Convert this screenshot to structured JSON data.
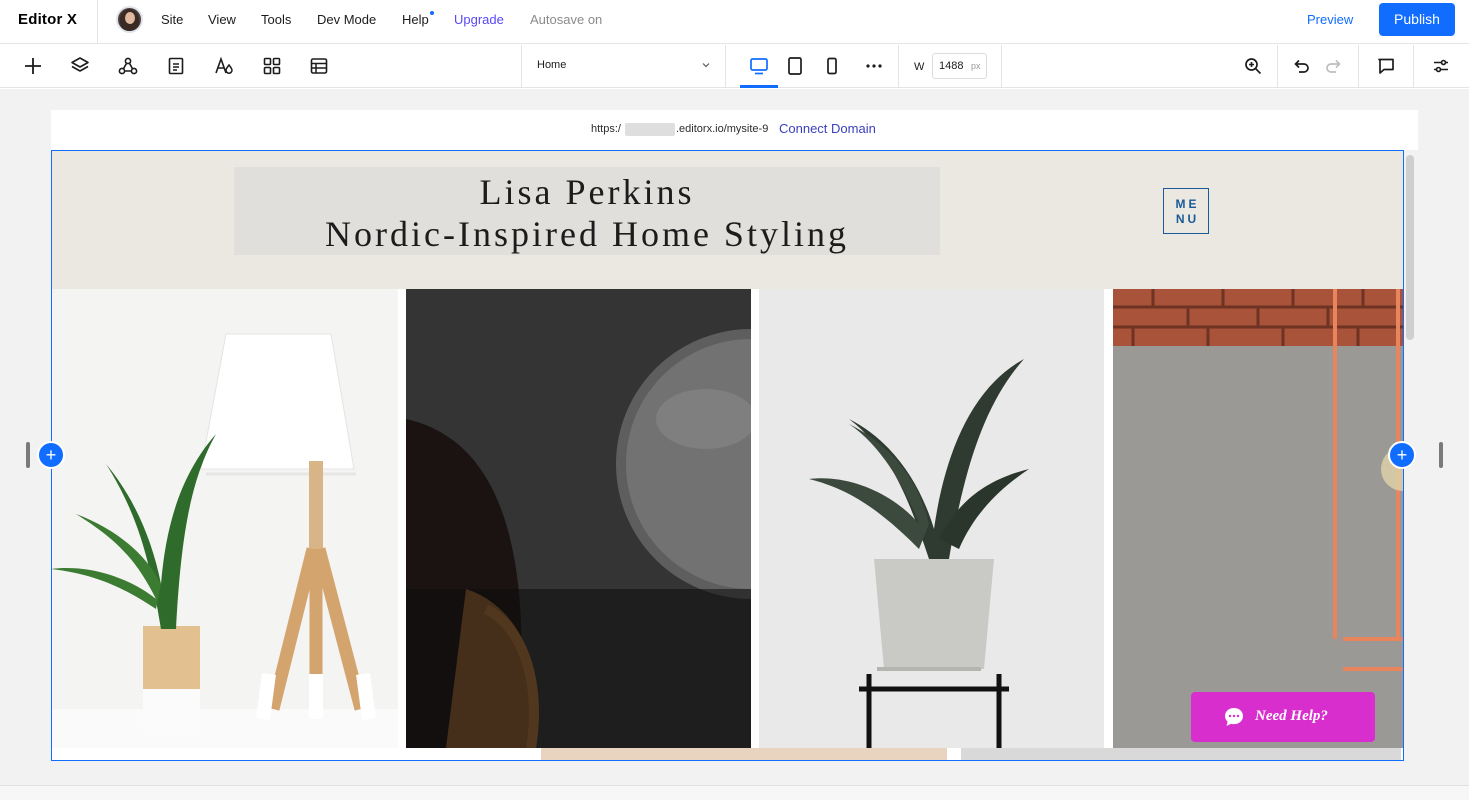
{
  "topbar": {
    "logo": "Editor X",
    "menu": {
      "site": "Site",
      "view": "View",
      "tools": "Tools",
      "dev_mode": "Dev Mode",
      "help": "Help",
      "upgrade": "Upgrade",
      "autosave": "Autosave on"
    },
    "preview": "Preview",
    "publish": "Publish"
  },
  "toolbar": {
    "page_selector": "Home",
    "width_label": "W",
    "width_value": "1488",
    "width_unit": "px",
    "active_breakpoint": "desktop"
  },
  "url_bar": {
    "prefix": "https:/",
    "rest": ".editorx.io/mysite-9",
    "connect_domain": "Connect Domain"
  },
  "site": {
    "title_line1": "Lisa Perkins",
    "title_line2": "Nordic-Inspired Home Styling",
    "menu_line1": "ME",
    "menu_line2": "NU"
  },
  "chat": {
    "label": "Need Help?"
  },
  "colors": {
    "accent": "#116dff",
    "upgrade": "#5a48f5",
    "header_bg": "#ebe7e1",
    "menu_border": "#1a5a96",
    "need_help_bg": "#d92ece"
  }
}
